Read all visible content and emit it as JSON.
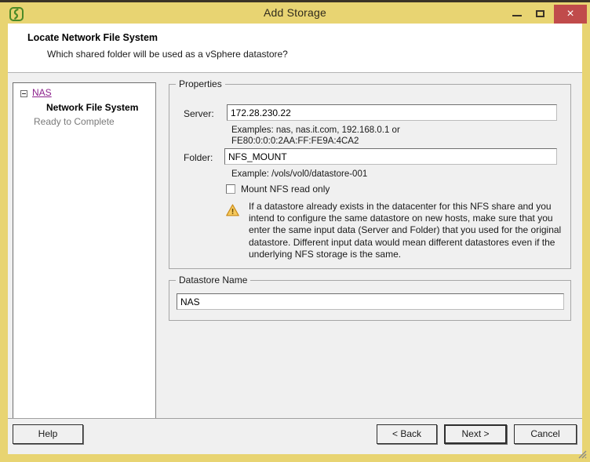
{
  "window": {
    "title": "Add Storage",
    "app_icon": "vsphere-app-icon",
    "controls": {
      "minimize": "minimize-icon",
      "maximize": "maximize-icon",
      "close": "×"
    },
    "close_color": "#c04b4b",
    "titlebar_color": "#e8d472"
  },
  "header": {
    "title": "Locate Network File System",
    "subtitle": "Which shared folder will be used as a vSphere datastore?"
  },
  "tree": {
    "items": [
      {
        "label": "NAS",
        "state": "link",
        "expander": "collapse-minus-icon"
      },
      {
        "label": "Network File System",
        "state": "current"
      },
      {
        "label": "Ready to Complete",
        "state": "pending"
      }
    ],
    "link_color": "#8b1f8b"
  },
  "properties": {
    "legend": "Properties",
    "server": {
      "label": "Server:",
      "value": "172.28.230.22",
      "placeholder": "",
      "hint": "Examples: nas, nas.it.com, 192.168.0.1 or\nFE80:0:0:0:2AA:FF:FE9A:4CA2"
    },
    "folder": {
      "label": "Folder:",
      "value": "NFS_MOUNT",
      "placeholder": "",
      "hint": "Example: /vols/vol0/datastore-001"
    },
    "mount_read_only": {
      "label": "Mount NFS read only",
      "checked": false
    },
    "warning": {
      "icon": "warning-triangle-icon",
      "color": "#f0a830",
      "text": "If a datastore already exists in the datacenter for this NFS share and you intend to configure the same datastore on new hosts, make sure that you enter the same input data (Server and Folder) that you used for the original datastore. Different input data would mean different datastores even if the underlying NFS storage is the same."
    }
  },
  "datastore": {
    "legend": "Datastore Name",
    "value": "NAS",
    "placeholder": ""
  },
  "footer": {
    "help_label": "Help",
    "back_label": "< Back",
    "next_label": "Next >",
    "cancel_label": "Cancel",
    "resize_grip": "resize-grip-icon"
  }
}
